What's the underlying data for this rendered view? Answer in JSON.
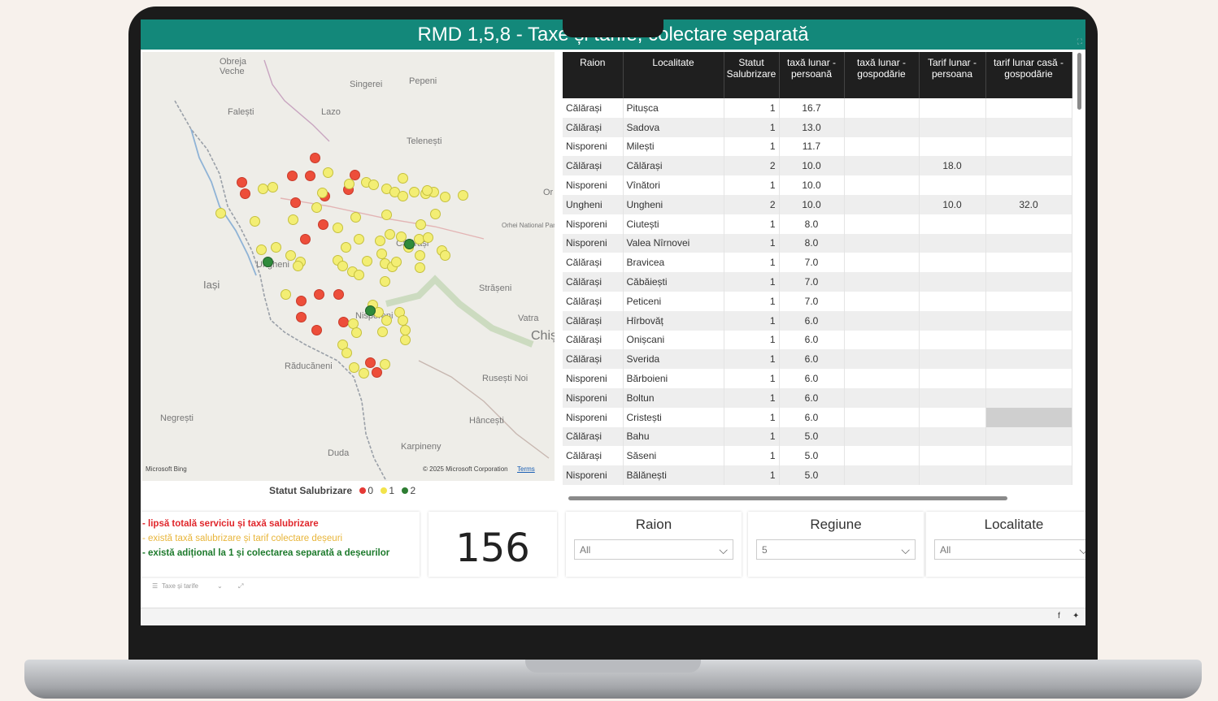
{
  "report_title": "RMD 1,5,8 - Taxe și tarife, colectare separată",
  "map": {
    "place_labels": [
      "Obreja Veche",
      "Singerei",
      "Pepeni",
      "Falești",
      "Lazo",
      "Telenești",
      "Orhei National Park",
      "Ungheni",
      "Iași",
      "Călărași",
      "Strășeni",
      "Vatra",
      "Chișinău",
      "Nisporeni",
      "Răducăneni",
      "Rusești Noi",
      "Hâncești",
      "Negrești",
      "Duda",
      "Karpineny",
      "Or"
    ],
    "credit": "© 2025 Microsoft Corporation",
    "terms": "Terms",
    "provider": "Microsoft Bing"
  },
  "legend": {
    "title": "Statut Salubrizare",
    "items": [
      {
        "label": "0",
        "color": "#e53935"
      },
      {
        "label": "1",
        "color": "#f2e34b"
      },
      {
        "label": "2",
        "color": "#2e7d32"
      }
    ]
  },
  "table": {
    "columns": [
      "Raion",
      "Localitate",
      "Statut Salubrizare",
      "taxă lunar - persoană",
      "taxă lunar - gospodărie",
      "Tarif lunar - persoana",
      "tarif lunar casă - gospodărie"
    ],
    "rows": [
      [
        "Călărași",
        "Pitușca",
        "1",
        "16.7",
        "",
        "",
        ""
      ],
      [
        "Călărași",
        "Sadova",
        "1",
        "13.0",
        "",
        "",
        ""
      ],
      [
        "Nisporeni",
        "Milești",
        "1",
        "11.7",
        "",
        "",
        ""
      ],
      [
        "Călărași",
        "Călărași",
        "2",
        "10.0",
        "",
        "18.0",
        ""
      ],
      [
        "Nisporeni",
        "Vînători",
        "1",
        "10.0",
        "",
        "",
        ""
      ],
      [
        "Ungheni",
        "Ungheni",
        "2",
        "10.0",
        "",
        "10.0",
        "32.0"
      ],
      [
        "Nisporeni",
        "Ciutești",
        "1",
        "8.0",
        "",
        "",
        ""
      ],
      [
        "Nisporeni",
        "Valea Nîrnovei",
        "1",
        "8.0",
        "",
        "",
        ""
      ],
      [
        "Călărași",
        "Bravicea",
        "1",
        "7.0",
        "",
        "",
        ""
      ],
      [
        "Călărași",
        "Căbăiești",
        "1",
        "7.0",
        "",
        "",
        ""
      ],
      [
        "Călărași",
        "Peticeni",
        "1",
        "7.0",
        "",
        "",
        ""
      ],
      [
        "Călărași",
        "Hîrbovăț",
        "1",
        "6.0",
        "",
        "",
        ""
      ],
      [
        "Călărași",
        "Onișcani",
        "1",
        "6.0",
        "",
        "",
        ""
      ],
      [
        "Călărași",
        "Sverida",
        "1",
        "6.0",
        "",
        "",
        ""
      ],
      [
        "Nisporeni",
        "Bărboieni",
        "1",
        "6.0",
        "",
        "",
        ""
      ],
      [
        "Nisporeni",
        "Boltun",
        "1",
        "6.0",
        "",
        "",
        ""
      ],
      [
        "Nisporeni",
        "Cristești",
        "1",
        "6.0",
        "",
        "",
        ""
      ],
      [
        "Călărași",
        "Bahu",
        "1",
        "5.0",
        "",
        "",
        ""
      ],
      [
        "Călărași",
        "Săseni",
        "1",
        "5.0",
        "",
        "",
        ""
      ],
      [
        "Nisporeni",
        "Bălănești",
        "1",
        "5.0",
        "",
        "",
        ""
      ]
    ]
  },
  "description": {
    "line_red": "- lipsă totală serviciu și taxă salubrizare",
    "line_yellow": "- există taxă salubrizare și tarif colectare deșeuri",
    "line_green": "- există adițional la 1 și colectarea separată a deșeurilor"
  },
  "kpi": {
    "value": "156"
  },
  "slicers": [
    {
      "title": "Raion",
      "value": "All"
    },
    {
      "title": "Regiune",
      "value": "5"
    },
    {
      "title": "Localitate",
      "value": "All"
    }
  ],
  "page_tab": "Taxe și tarife",
  "colors": {
    "title_bar": "#13887a",
    "header_bg": "#1f1f1f",
    "red": "#ed4e3a",
    "yellow": "#f3ee74",
    "green": "#2f8a3b"
  }
}
